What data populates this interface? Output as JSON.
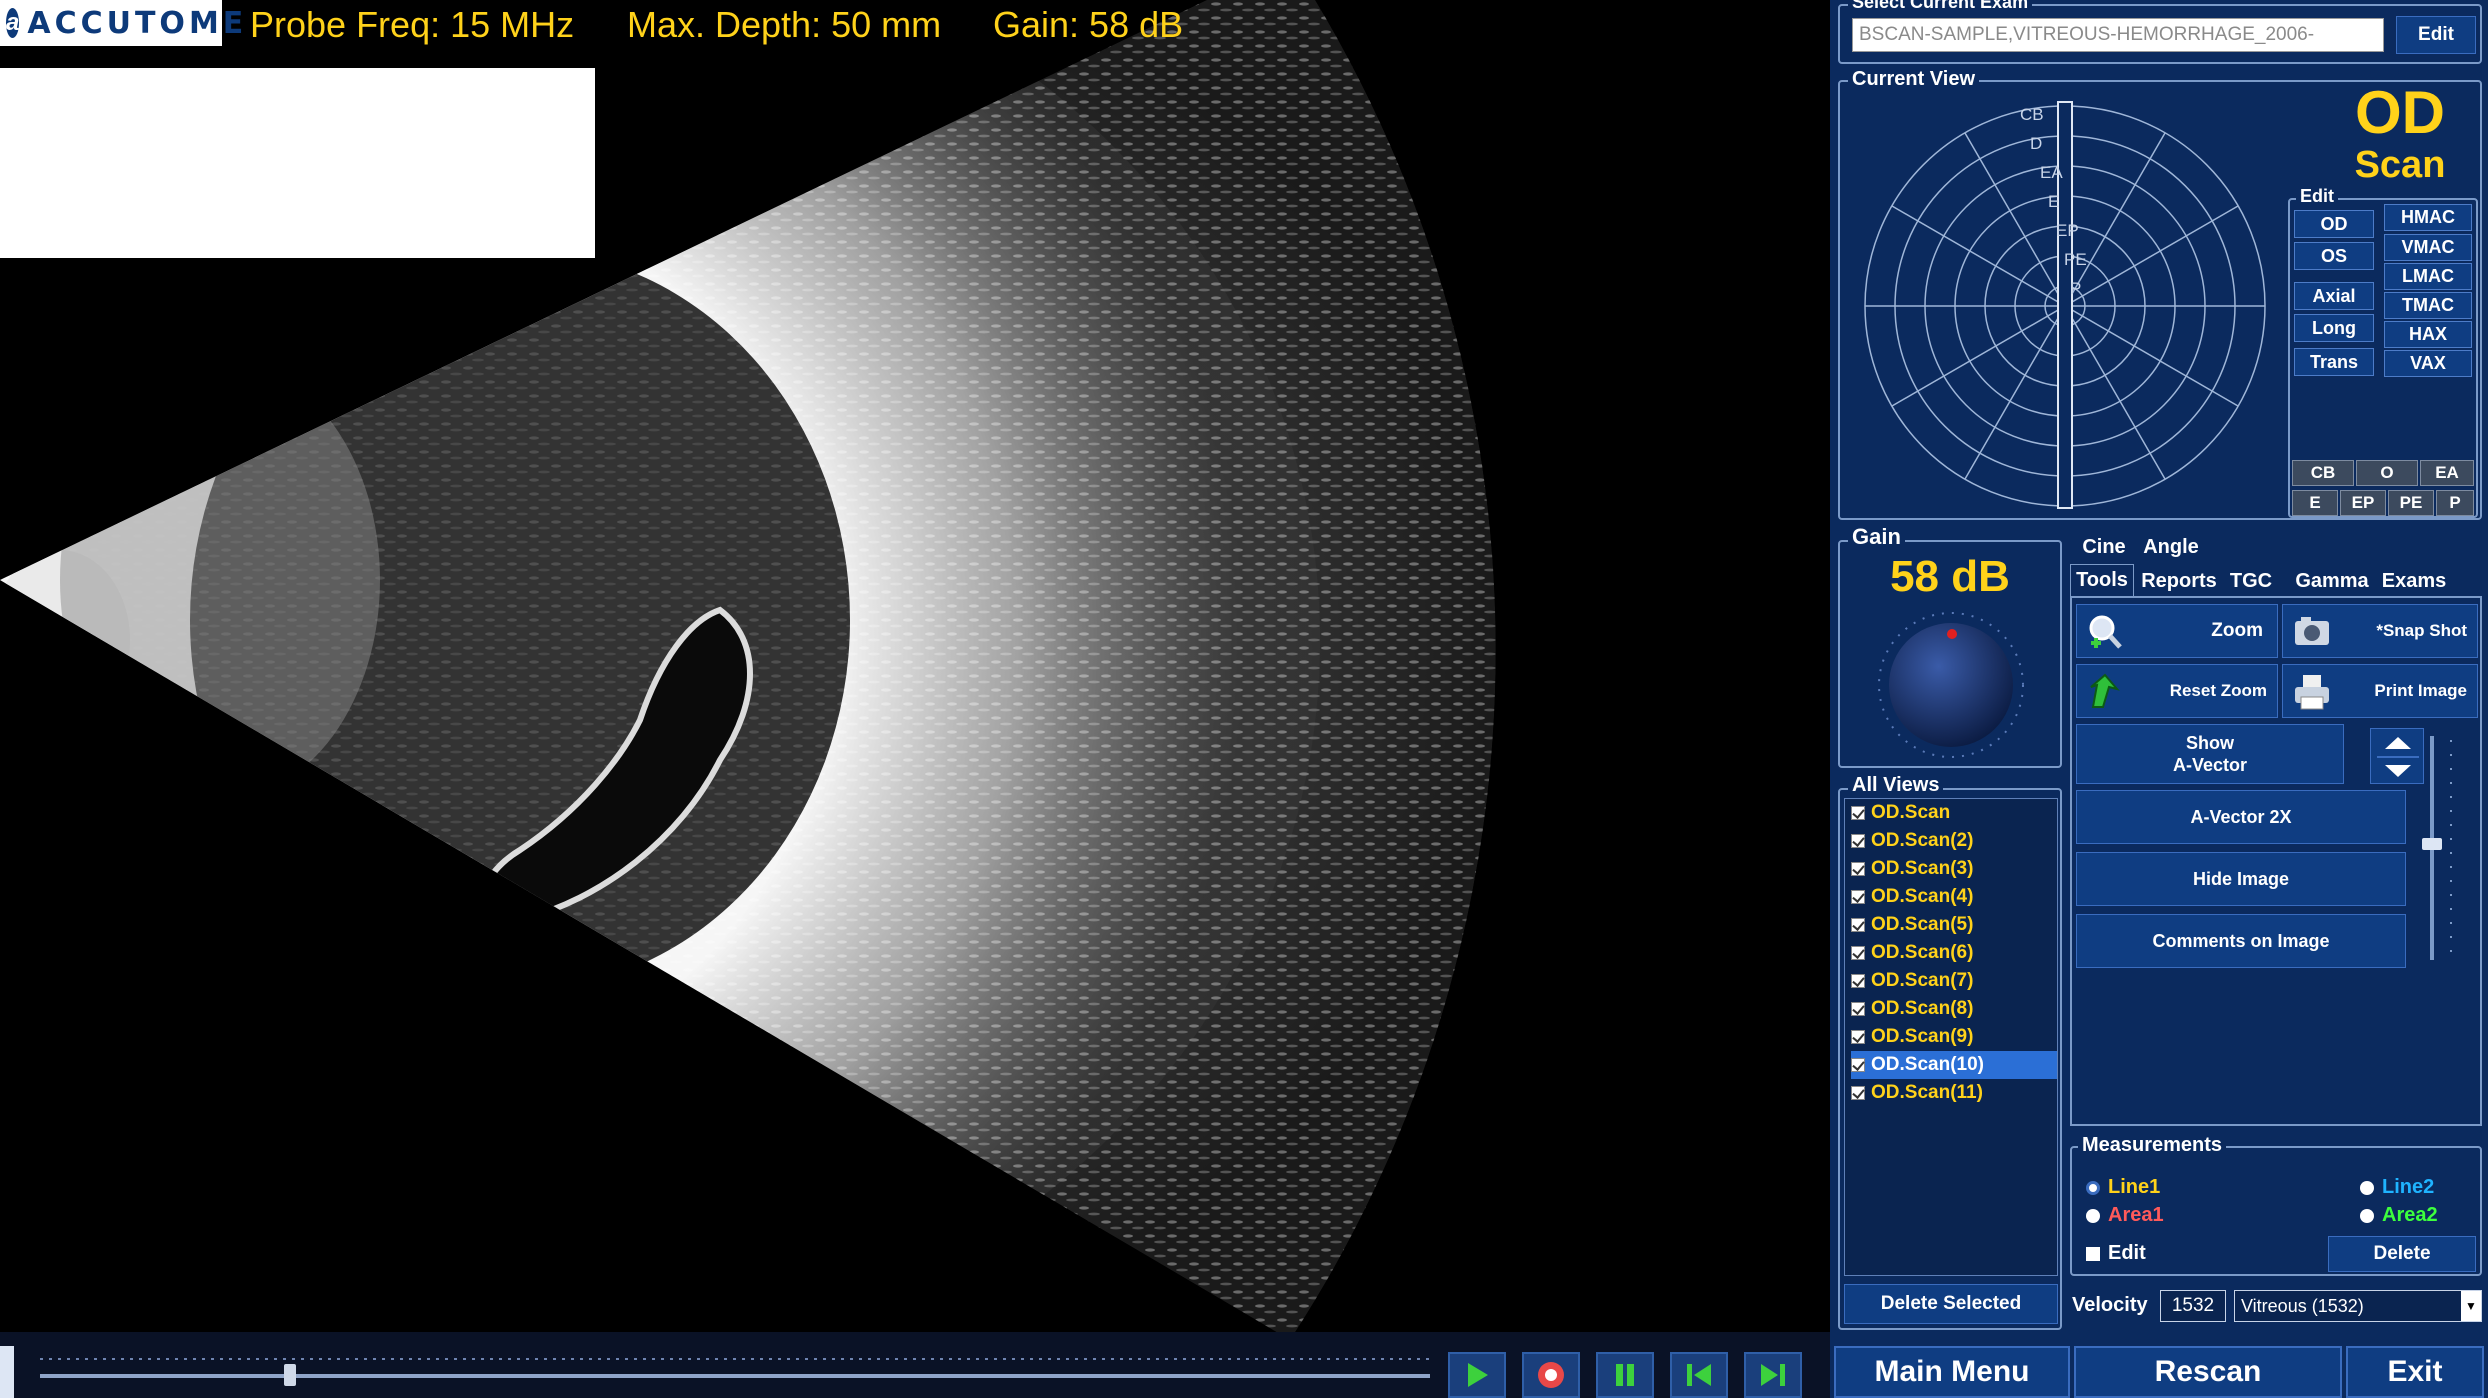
{
  "header": {
    "logo_text": "ACCUTOME",
    "probe_freq": "Probe Freq: 15 MHz",
    "max_depth": "Max. Depth: 50 mm",
    "gain": "Gain: 58 dB"
  },
  "exam": {
    "group_title": "Select Current Exam",
    "value": "BSCAN-SAMPLE,VITREOUS-HEMORRHAGE_2006-",
    "edit_label": "Edit"
  },
  "current_view": {
    "group_title": "Current View",
    "eye": "OD",
    "mode": "Scan",
    "clock_labels": [
      "CB",
      "D",
      "EA",
      "E",
      "EP",
      "PE",
      "P"
    ],
    "edit": {
      "group_title": "Edit",
      "left_buttons": [
        "OD",
        "OS",
        "Axial",
        "Long",
        "Trans"
      ],
      "right_buttons": [
        "HMAC",
        "VMAC",
        "LMAC",
        "TMAC",
        "HAX",
        "VAX"
      ],
      "grid_row1": [
        "CB",
        "O",
        "EA"
      ],
      "grid_row2": [
        "E",
        "EP",
        "PE",
        "P"
      ]
    }
  },
  "gain_panel": {
    "group_title": "Gain",
    "value": "58 dB"
  },
  "tabs": {
    "row1": [
      "Cine",
      "Angle"
    ],
    "row2": [
      "Tools",
      "Reports",
      "TGC",
      "Gamma",
      "Exams"
    ],
    "active": "Tools"
  },
  "tools": {
    "zoom": "Zoom",
    "snapshot": "*Snap Shot",
    "reset_zoom": "Reset Zoom",
    "print_image": "Print Image",
    "show_avector": "Show\nA-Vector",
    "avector_2x": "A-Vector 2X",
    "hide_image": "Hide Image",
    "comments": "Comments on Image"
  },
  "all_views": {
    "group_title": "All Views",
    "items": [
      "OD.Scan",
      "OD.Scan(2)",
      "OD.Scan(3)",
      "OD.Scan(4)",
      "OD.Scan(5)",
      "OD.Scan(6)",
      "OD.Scan(7)",
      "OD.Scan(8)",
      "OD.Scan(9)",
      "OD.Scan(10)",
      "OD.Scan(11)"
    ],
    "selected_index": 9,
    "delete_label": "Delete Selected"
  },
  "measurements": {
    "group_title": "Measurements",
    "line1": "Line1",
    "line2": "Line2",
    "area1": "Area1",
    "area2": "Area2",
    "edit": "Edit",
    "delete": "Delete",
    "colors": {
      "line1": "#ffd21a",
      "line2": "#1fb3ff",
      "area1": "#ff5a5a",
      "area2": "#3dff3d"
    }
  },
  "velocity": {
    "label": "Velocity",
    "value": "1532",
    "preset": "Vitreous (1532)"
  },
  "bottom": {
    "main_menu": "Main Menu",
    "rescan": "Rescan",
    "exit": "Exit"
  },
  "playback": {
    "position": 0.18,
    "buttons": [
      "play-icon",
      "record-icon",
      "pause-icon",
      "step-back-icon",
      "step-forward-icon"
    ]
  }
}
